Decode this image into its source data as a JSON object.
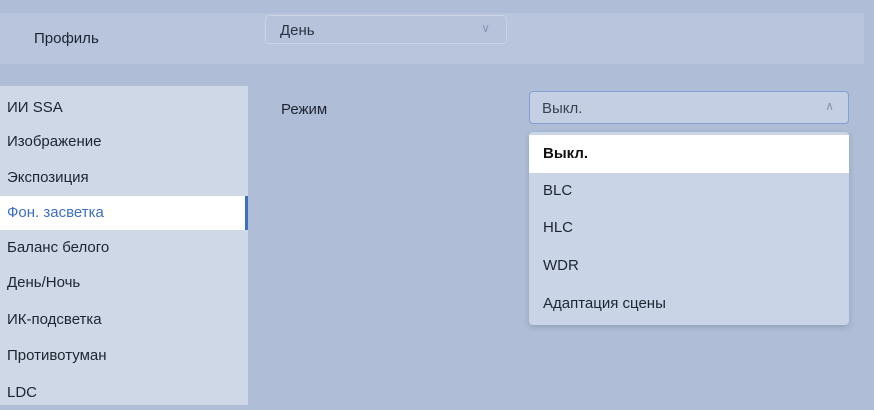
{
  "header": {
    "profile_label": "Профиль",
    "profile_value": "День",
    "chevron_icon": "chevron-down-icon"
  },
  "sidebar": {
    "items": [
      {
        "label": "ИИ SSA"
      },
      {
        "label": "Изображение"
      },
      {
        "label": "Экспозиция"
      },
      {
        "label": "Фон. засветка",
        "active": true
      },
      {
        "label": "Баланс белого"
      },
      {
        "label": "День/Ночь"
      },
      {
        "label": "ИК-подсветка"
      },
      {
        "label": "Противотуман"
      },
      {
        "label": "LDC"
      }
    ]
  },
  "form": {
    "mode_label": "Режим",
    "mode_value": "Выкл.",
    "chevron_icon": "chevron-up-icon",
    "options": [
      {
        "label": "Выкл.",
        "selected": true
      },
      {
        "label": "BLC"
      },
      {
        "label": "HLC"
      },
      {
        "label": "WDR"
      },
      {
        "label": "Адаптация сцены"
      }
    ]
  },
  "colors": {
    "accent": "#3e6fc2",
    "background": "#afbdd6",
    "sidebar": "#cfd8e6"
  }
}
